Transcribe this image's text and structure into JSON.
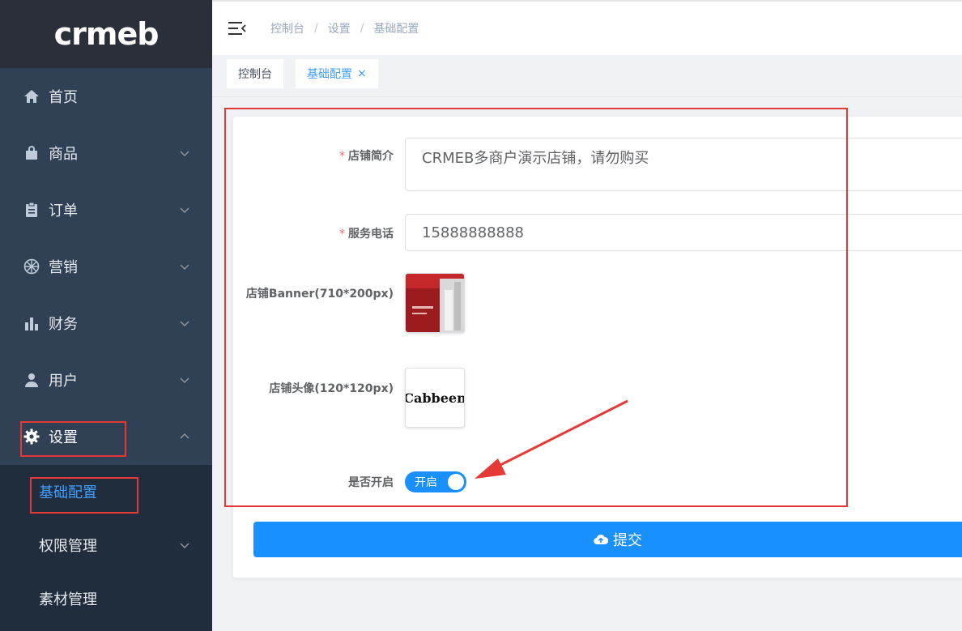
{
  "brand": {
    "logo_text": "crmeb"
  },
  "sidebar": {
    "items": [
      {
        "label": "首页",
        "icon": "home-icon"
      },
      {
        "label": "商品",
        "icon": "bag-icon"
      },
      {
        "label": "订单",
        "icon": "clipboard-icon"
      },
      {
        "label": "营销",
        "icon": "wheel-icon"
      },
      {
        "label": "财务",
        "icon": "bar-chart-icon"
      },
      {
        "label": "用户",
        "icon": "user-icon"
      },
      {
        "label": "设置",
        "icon": "gear-icon"
      }
    ],
    "submenu": [
      {
        "label": "基础配置"
      },
      {
        "label": "权限管理"
      },
      {
        "label": "素材管理"
      }
    ]
  },
  "header": {
    "breadcrumb": [
      "控制台",
      "设置",
      "基础配置"
    ],
    "separator": "/"
  },
  "tags": [
    {
      "label": "控制台"
    },
    {
      "label": "基础配置",
      "close": "×"
    }
  ],
  "form": {
    "intro": {
      "label": "店铺简介",
      "required_mark": "*",
      "value": "CRMEB多商户演示店铺，请勿购买"
    },
    "phone": {
      "label": "服务电话",
      "required_mark": "*",
      "value": "15888888888"
    },
    "banner": {
      "label": "店铺Banner(710*200px)"
    },
    "avatar": {
      "label": "店铺头像(120*120px)",
      "image_text": "Cabbeen"
    },
    "enabled": {
      "label": "是否开启",
      "switch_text": "开启",
      "value": true
    },
    "submit_label": "提交"
  },
  "colors": {
    "sidebar_bg": "#304156",
    "submenu_bg": "#1f2d3d",
    "primary": "#1890ff",
    "annotation_red": "#e53935"
  }
}
